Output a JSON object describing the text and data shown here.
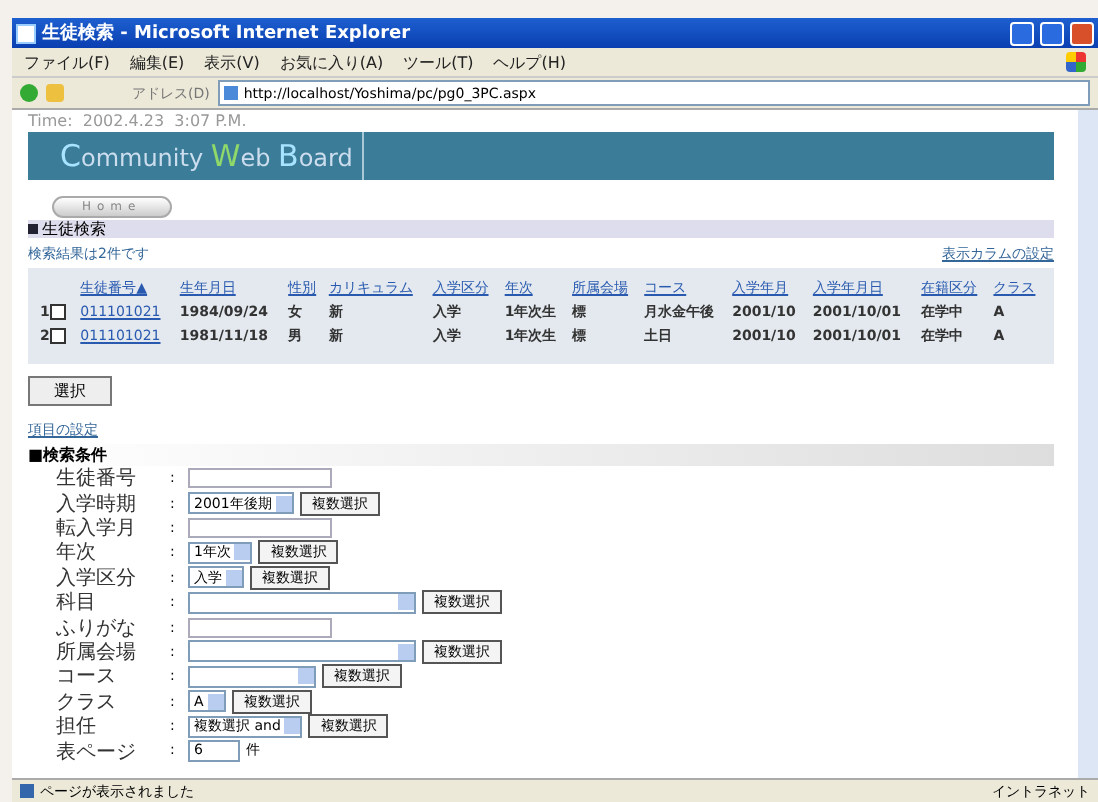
{
  "window": {
    "title": "生徒検索 - Microsoft Internet Explorer"
  },
  "menu": [
    "ファイル(F)",
    "編集(E)",
    "表示(V)",
    "お気に入り(A)",
    "ツール(T)",
    "ヘルプ(H)"
  ],
  "address": {
    "label": "アドレス(D)",
    "url": "http://localhost/Yoshima/pc/pg0_3PC.aspx"
  },
  "page": {
    "time": "Time:  2002.4.23  3:07 P.M.",
    "logo": [
      "C",
      "ommunity ",
      "W",
      "eb ",
      "B",
      "oard"
    ],
    "home": "Home",
    "section": "生徒検索"
  },
  "results": {
    "summary": "検索結果は2件です",
    "column_settings": "表示カラムの設定",
    "columns": [
      "生徒番号▲",
      "生年月日",
      "性別",
      "カリキュラム",
      "入学区分",
      "年次",
      "所属会場",
      "コース",
      "入学年月",
      "入学年月日",
      "在籍区分",
      "クラス"
    ],
    "rows": [
      {
        "index": "1",
        "checked": false,
        "cells": [
          "011101021",
          "1984/09/24",
          "女",
          "新",
          "入学",
          "1年次生",
          "標",
          "月水金午後",
          "2001/10",
          "2001/10/01",
          "在学中",
          "A"
        ]
      },
      {
        "index": "2",
        "checked": false,
        "cells": [
          "011101021",
          "1981/11/18",
          "男",
          "新",
          "入学",
          "1年次生",
          "標",
          "土日",
          "2001/10",
          "2001/10/01",
          "在学中",
          "A"
        ]
      }
    ],
    "select_button": "選択"
  },
  "search": {
    "item_settings": "項目の設定",
    "title": "■検索条件",
    "separator": ":",
    "fields": [
      {
        "label": "生徒番号",
        "kind": "text"
      },
      {
        "label": "入学時期",
        "kind": "select",
        "value": "2001年後期",
        "button": "複数選択"
      },
      {
        "label": "転入学月",
        "kind": "text"
      },
      {
        "label": "年次",
        "kind": "select",
        "value": "1年次",
        "button": "複数選択"
      },
      {
        "label": "入学区分",
        "kind": "select",
        "value": "入学",
        "button": "複数選択"
      },
      {
        "label": "科目",
        "kind": "select",
        "wide": true,
        "button": "複数選択"
      },
      {
        "label": "ふりがな",
        "kind": "text"
      },
      {
        "label": "所属会場",
        "kind": "select",
        "wide": true,
        "button": "複数選択"
      },
      {
        "label": "コース",
        "kind": "select",
        "button": "複数選択"
      },
      {
        "label": "クラス",
        "kind": "select",
        "value": "A",
        "button": "複数選択"
      },
      {
        "label": "担任",
        "kind": "select",
        "value": "複数選択 and",
        "button": "複数選択"
      },
      {
        "label": "表ページ",
        "kind": "count",
        "value": "6",
        "unit": "件"
      }
    ]
  },
  "status": {
    "text": "ページが表示されました",
    "zone": "イントラネット"
  }
}
